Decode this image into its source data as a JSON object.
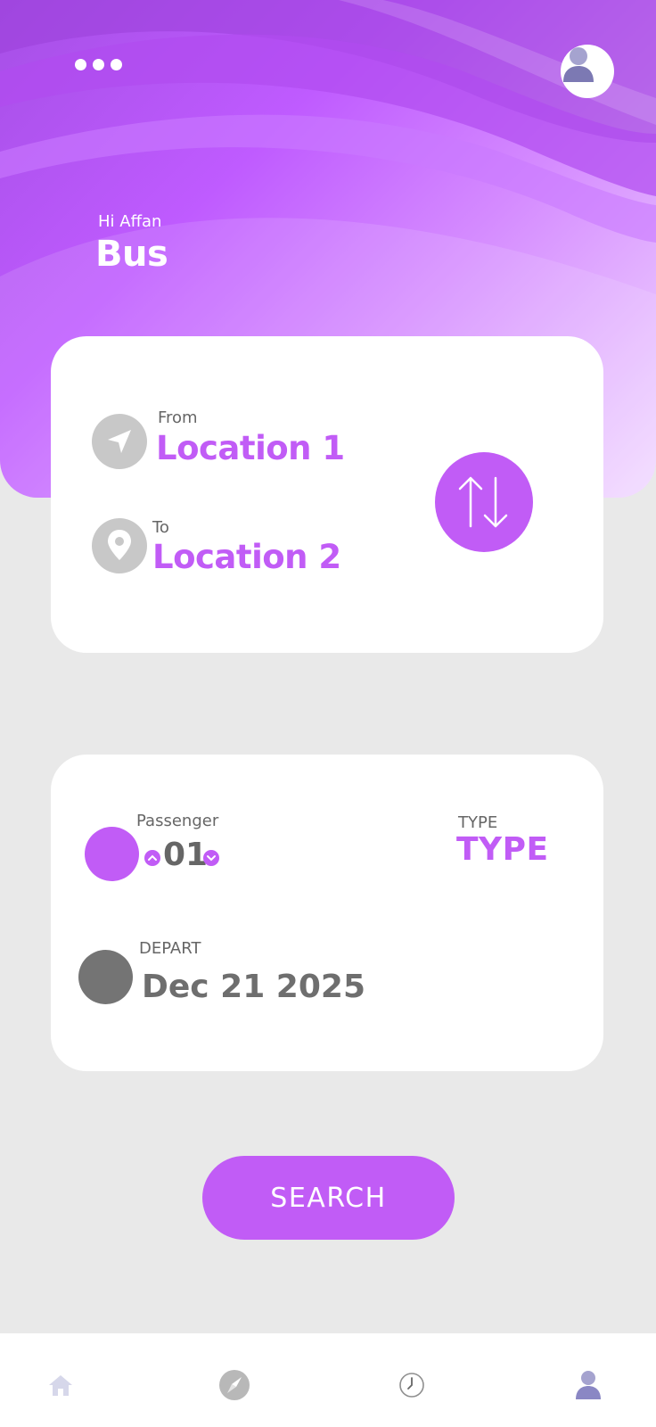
{
  "header": {
    "greeting": "Hi Affan",
    "title": "Bus",
    "menu_icon": "more-dots-icon",
    "avatar_icon": "user-avatar-icon"
  },
  "route": {
    "from_label": "From",
    "from_value": "Location 1",
    "to_label": "To",
    "to_value": "Location 2",
    "from_icon": "navigation-arrow-icon",
    "to_icon": "location-pin-icon",
    "swap_icon": "swap-vertical-icon"
  },
  "options": {
    "passenger_label": "Passenger",
    "passenger_count": "01",
    "type_label": "TYPE",
    "type_value": "TYPE",
    "depart_label": "DEPART",
    "depart_value": "Dec 21 2025"
  },
  "search_label": "SEARCH",
  "nav": {
    "items": [
      {
        "name": "home",
        "icon": "home-icon"
      },
      {
        "name": "explore",
        "icon": "compass-icon"
      },
      {
        "name": "history",
        "icon": "clock-icon"
      },
      {
        "name": "profile",
        "icon": "user-icon"
      }
    ]
  },
  "colors": {
    "accent": "#c15cf6",
    "background": "#e9e9e9",
    "muted_icon": "#c8c8c8",
    "nav_icon": "#d6d7ea",
    "nav_active": "#8a87c4"
  }
}
